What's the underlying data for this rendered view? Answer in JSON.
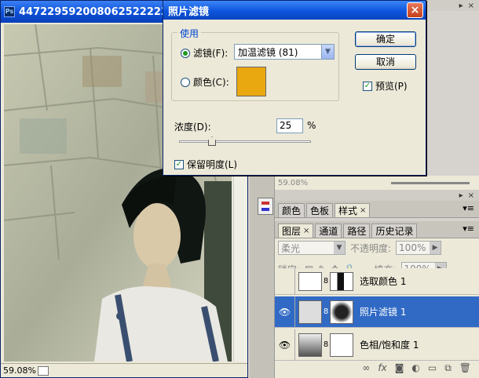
{
  "document": {
    "title": "4472295920080625222238511",
    "zoom": "59.08%"
  },
  "dialog": {
    "title": "照片滤镜",
    "use_group": "使用",
    "filter_label": "滤镜(F):",
    "filter_value": "加温滤镜 (81)",
    "color_label": "颜色(C):",
    "color_swatch": "#eaa810",
    "ok": "确定",
    "cancel": "取消",
    "preview": "预览(P)",
    "density_label": "浓度(D):",
    "density_value": "25",
    "density_unit": "%",
    "density_level": 0.25,
    "preserve_luminosity": "保留明度(L)"
  },
  "panels": {
    "mid_zoom": "59.08%",
    "swatches_tabs": [
      "颜色",
      "色板",
      "样式"
    ],
    "layers_tabs": [
      "图层",
      "通道",
      "路径",
      "历史记录"
    ],
    "blend_mode": "柔光",
    "opacity_label": "不透明度:",
    "opacity_value": "100%",
    "lock_label": "锁定:",
    "fill_label": "填充:",
    "fill_value": "100%"
  },
  "layers": [
    {
      "name": "选取颜色 1",
      "selected": false
    },
    {
      "name": "照片滤镜 1",
      "selected": true
    },
    {
      "name": "色相/饱和度 1",
      "selected": false
    }
  ],
  "icons": [
    "close-icon",
    "eye-icon",
    "link-icon",
    "fx-icon",
    "mask-icon",
    "adjustment-icon",
    "folder-icon",
    "new-layer-icon",
    "trash-icon",
    "lock-icon",
    "brush-icon",
    "move-icon"
  ]
}
